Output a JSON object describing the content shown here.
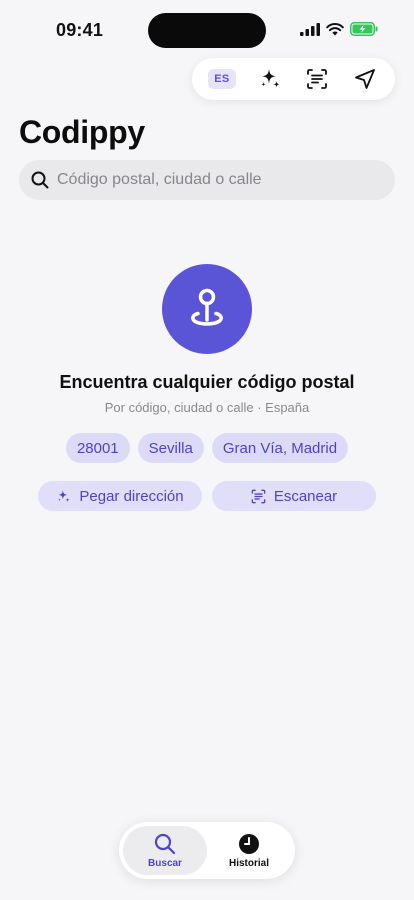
{
  "status_bar": {
    "time": "09:41"
  },
  "toolbar": {
    "language": "ES"
  },
  "app": {
    "title": "Codippy"
  },
  "search": {
    "placeholder": "Código postal, ciudad o calle",
    "value": ""
  },
  "hero": {
    "title": "Encuentra cualquier código postal",
    "subtitle": "Por código, ciudad o calle · España"
  },
  "suggestions": [
    "28001",
    "Sevilla",
    "Gran Vía, Madrid"
  ],
  "actions": {
    "paste_label": "Pegar dirección",
    "scan_label": "Escanear"
  },
  "tabs": [
    {
      "label": "Buscar",
      "icon": "search-icon",
      "active": true
    },
    {
      "label": "Historial",
      "icon": "clock-icon",
      "active": false
    }
  ],
  "colors": {
    "accent": "#5a55d6",
    "chip_bg": "#dcdaf7",
    "background": "#f6f6f8"
  }
}
